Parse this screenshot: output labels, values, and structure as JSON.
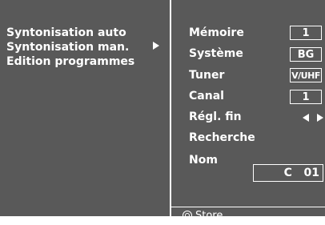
{
  "menu": {
    "items": [
      {
        "label": "Syntonisation auto"
      },
      {
        "label": "Syntonisation man."
      },
      {
        "label": "Edition programmes"
      }
    ]
  },
  "settings": {
    "memoire": {
      "label": "Mémoire",
      "value": "1"
    },
    "systeme": {
      "label": "Système",
      "value": "BG"
    },
    "tuner": {
      "label": "Tuner",
      "value": "V/UHF"
    },
    "canal": {
      "label": "Canal",
      "value": "1"
    },
    "regl_fin": {
      "label": "Régl. fin"
    },
    "recherche": {
      "label": "Recherche"
    },
    "nom": {
      "label": "Nom",
      "value": "C   01"
    }
  },
  "footer": {
    "store_label": "Store"
  },
  "colors": {
    "background": "#595959",
    "foreground": "#ffffff"
  },
  "icons": {
    "selected_arrow": "triangle-right-icon",
    "fine_tune": "left-right-arrows-icon",
    "store": "circle-button-icon"
  }
}
